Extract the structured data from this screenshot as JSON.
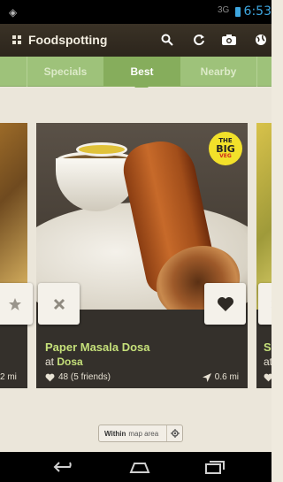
{
  "status_bar": {
    "network": "3G",
    "time": "6:53"
  },
  "action_bar": {
    "title": "Foodspotting"
  },
  "tabs": [
    {
      "label": "Specials"
    },
    {
      "label": "Best"
    },
    {
      "label": "Nearby"
    }
  ],
  "cards": {
    "main": {
      "dish": "Paper Masala Dosa",
      "at_prefix": "at",
      "place": "Dosa",
      "likes": "48 (5 friends)",
      "distance": "0.6 mi",
      "badge": {
        "line1": "THE",
        "line2": "BIG",
        "line3": "VEG"
      }
    },
    "left_peek": {
      "distance": "2 mi"
    },
    "right_peek": {
      "dish_fragment": "S",
      "at_fragment": "at"
    }
  },
  "map_button": {
    "bold": "Within",
    "rest": "map area"
  },
  "colors": {
    "accent_green": "#c5e07a",
    "tab_bar": "#9ec27a",
    "system_blue": "#3ea7e0"
  }
}
